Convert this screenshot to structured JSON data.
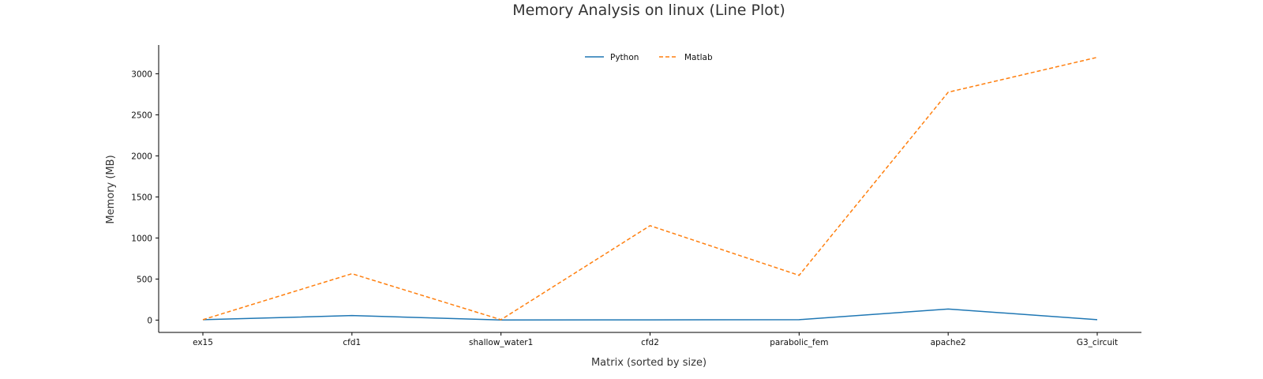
{
  "chart_data": {
    "type": "line",
    "title": "Memory Analysis on linux (Line Plot)",
    "xlabel": "Matrix (sorted by size)",
    "ylabel": "Memory (MB)",
    "categories": [
      "ex15",
      "cfd1",
      "shallow_water1",
      "cfd2",
      "parabolic_fem",
      "apache2",
      "G3_circuit"
    ],
    "ylim": [
      -150,
      3350
    ],
    "yticks": [
      0,
      500,
      1000,
      1500,
      2000,
      2500,
      3000
    ],
    "grid": false,
    "legend_position": "top-center",
    "series": [
      {
        "name": "Python",
        "values": [
          5,
          55,
          2,
          3,
          5,
          135,
          5
        ],
        "color": "#1f77b4",
        "dash": "solid"
      },
      {
        "name": "Matlab",
        "values": [
          5,
          565,
          5,
          1150,
          545,
          2775,
          3200
        ],
        "color": "#ff7f0e",
        "dash": "dashed"
      }
    ]
  }
}
